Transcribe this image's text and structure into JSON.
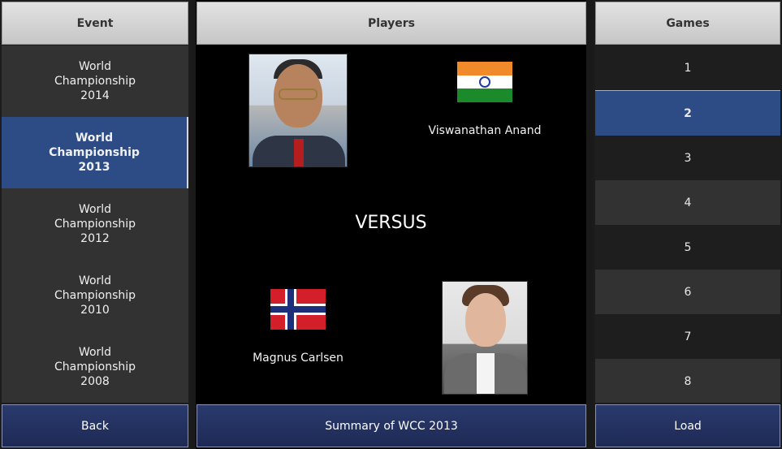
{
  "event_column": {
    "header": "Event",
    "items": [
      {
        "label": "World\nChampionship\n2014",
        "selected": false
      },
      {
        "label": "World\nChampionship\n2013",
        "selected": true
      },
      {
        "label": "World\nChampionship\n2012",
        "selected": false
      },
      {
        "label": "World\nChampionship\n2010",
        "selected": false
      },
      {
        "label": "World\nChampionship\n2008",
        "selected": false
      }
    ],
    "back_label": "Back"
  },
  "players_column": {
    "header": "Players",
    "player_top": {
      "name": "Viswanathan Anand",
      "flag_icon": "india-flag-icon"
    },
    "versus_label": "VERSUS",
    "player_bottom": {
      "name": "Magnus Carlsen",
      "flag_icon": "norway-flag-icon"
    },
    "summary_label": "Summary of WCC 2013"
  },
  "games_column": {
    "header": "Games",
    "items": [
      "1",
      "2",
      "3",
      "4",
      "5",
      "6",
      "7",
      "8"
    ],
    "selected": "2",
    "load_label": "Load"
  },
  "colors": {
    "selected": "#2d4c86",
    "button": "#1e2a55",
    "header": "#d0d0d0"
  }
}
